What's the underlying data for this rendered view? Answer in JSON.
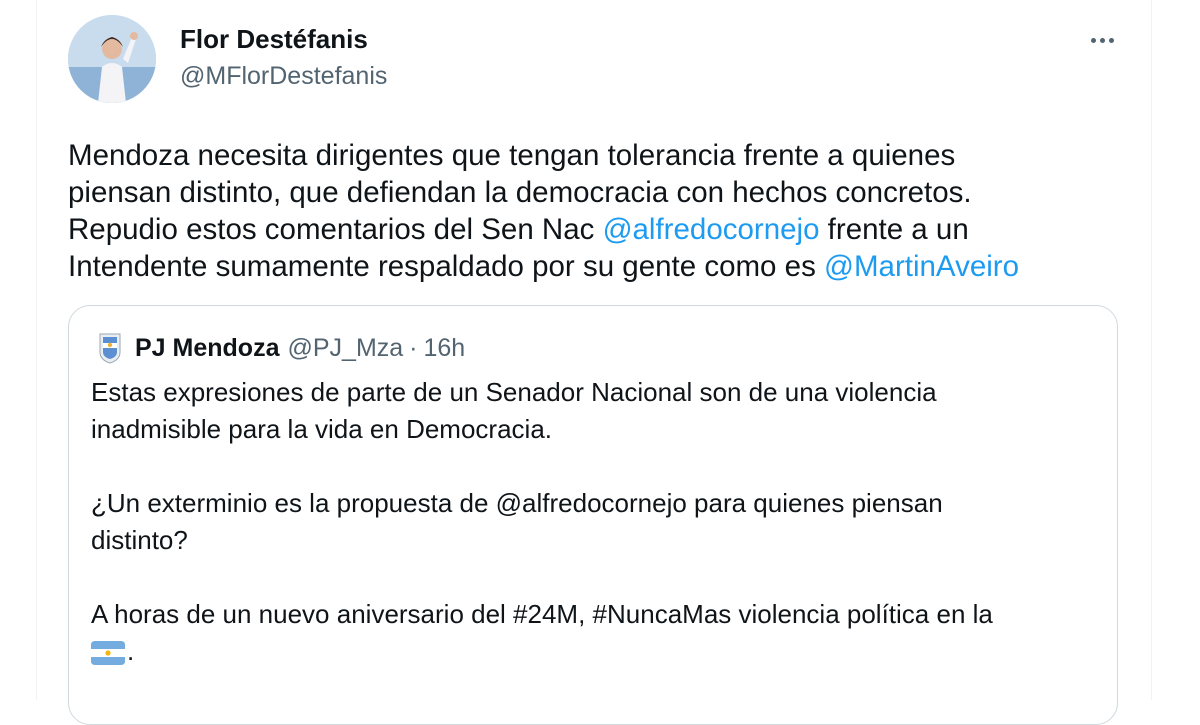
{
  "author": {
    "display_name": "Flor Destéfanis",
    "handle": "@MFlorDestefanis",
    "avatar_icon": "profile-photo"
  },
  "more_icon": "more-options-icon",
  "tweet": {
    "line1": "Mendoza necesita dirigentes que tengan tolerancia frente a quienes",
    "line2": "piensan distinto, que defiendan la democracia con hechos concretos.",
    "line3_pre": "Repudio estos comentarios del Sen Nac ",
    "line3_mention": "@alfredocornejo",
    "line3_post": " frente a un",
    "line4_pre": "Intendente sumamente respaldado por su gente como es ",
    "line4_mention": "@MartinAveiro"
  },
  "quote": {
    "author_name": "PJ Mendoza",
    "author_handle": "@PJ_Mza",
    "separator": "·",
    "time": "16h",
    "avatar_icon": "pj-logo-icon",
    "p1_line1": "Estas expresiones de parte de un Senador Nacional son de una violencia",
    "p1_line2": "inadmisible para la vida en Democracia.",
    "p2_line1": "¿Un exterminio es la propuesta de @alfredocornejo para quienes piensan",
    "p2_line2": "distinto?",
    "p3_line1": "A horas de un nuevo aniversario del #24M, #NuncaMas violencia política en la",
    "p3_line2_suffix": ".",
    "flag_icon": "argentina-flag-emoji"
  },
  "colors": {
    "text": "#0f1419",
    "secondary": "#536471",
    "link": "#1d9bf0",
    "border": "#cfd9de"
  }
}
